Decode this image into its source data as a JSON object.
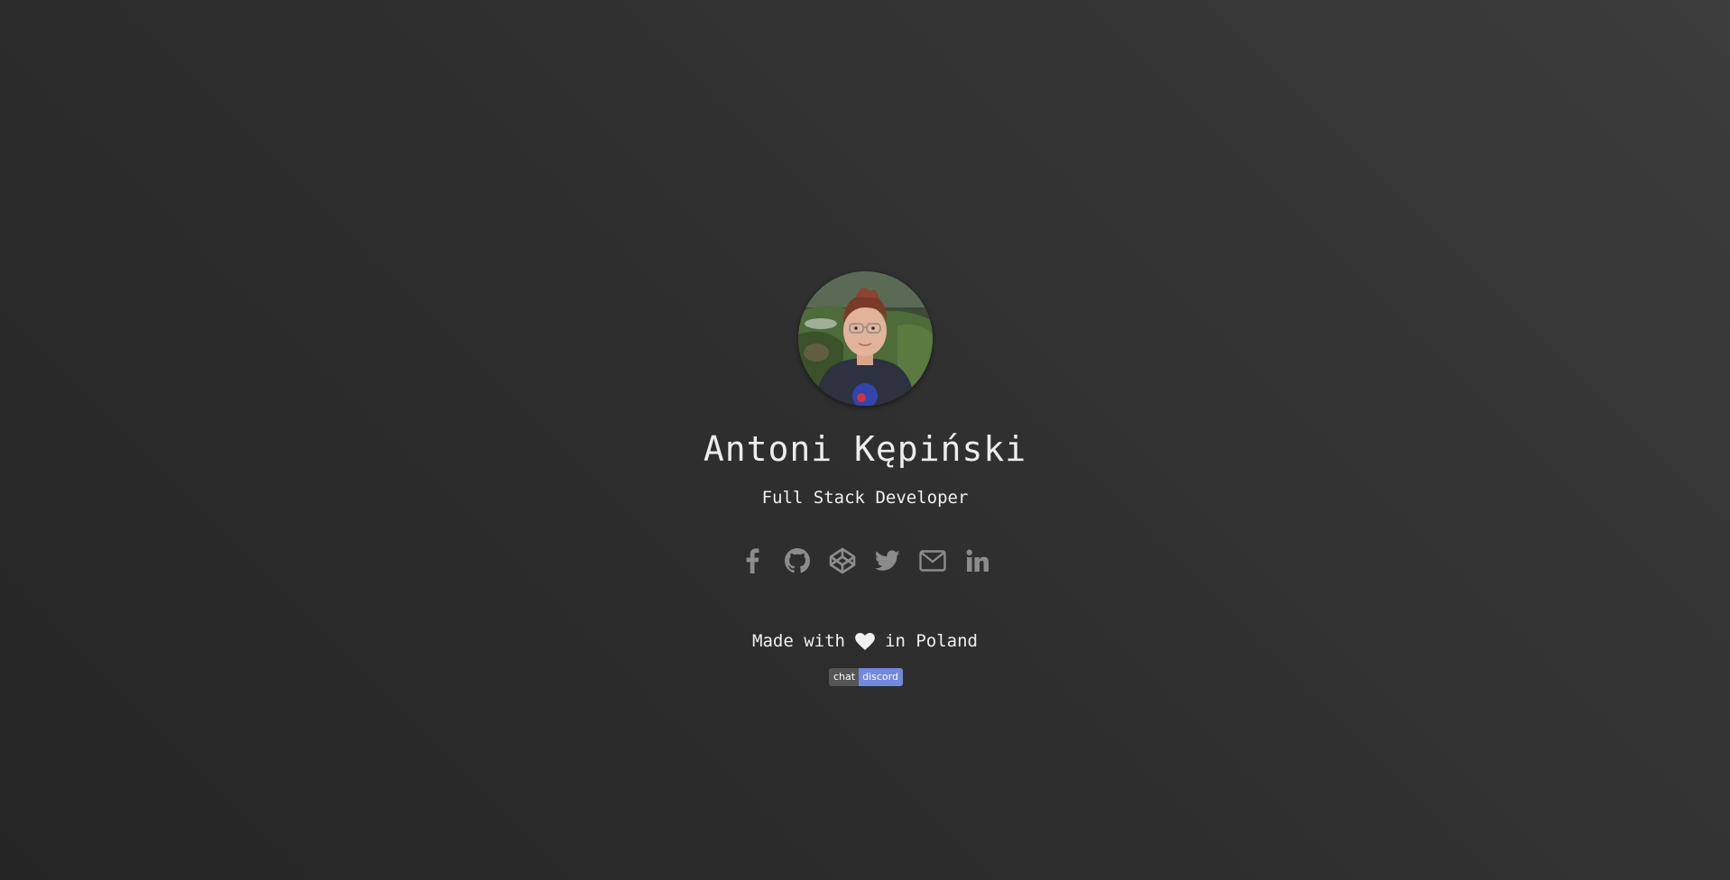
{
  "profile": {
    "name": "Antoni Kępiński",
    "role": "Full Stack Developer",
    "avatar_alt": "Profile photo"
  },
  "socials": [
    {
      "name": "facebook",
      "icon": "facebook-icon"
    },
    {
      "name": "github",
      "icon": "github-icon"
    },
    {
      "name": "codepen",
      "icon": "codepen-icon"
    },
    {
      "name": "twitter",
      "icon": "twitter-icon"
    },
    {
      "name": "email",
      "icon": "envelope-icon"
    },
    {
      "name": "linkedin",
      "icon": "linkedin-icon"
    }
  ],
  "footer": {
    "made_with": "Made with",
    "heart_icon": "heart-icon",
    "location": "in Poland"
  },
  "badge": {
    "left": "chat",
    "right": "discord",
    "right_color": "#7289da"
  },
  "colors": {
    "icon_color": "#8c8c8c",
    "text_color": "#f0f0f0"
  }
}
